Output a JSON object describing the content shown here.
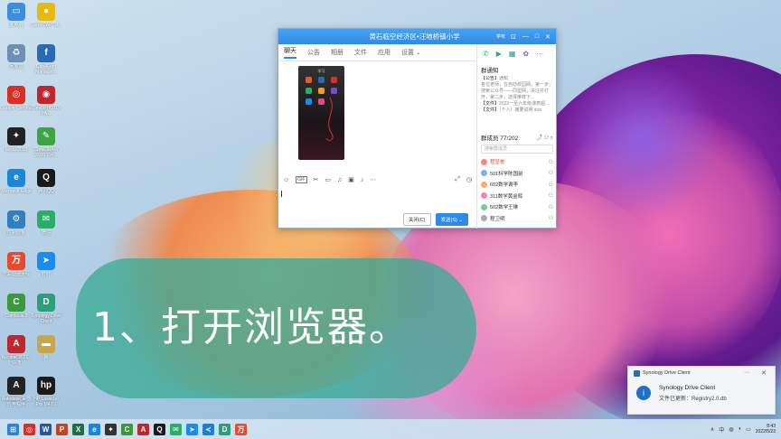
{
  "desktop": {
    "icons": [
      {
        "label": "此电脑",
        "glyph": "▭",
        "color": "#3b8ede"
      },
      {
        "label": "Corel CAPTU...",
        "glyph": "●",
        "color": "#e8b90f"
      },
      {
        "label": "回收站",
        "glyph": "♻",
        "color": "#6b8fb5"
      },
      {
        "label": "CorelFont Manager...",
        "glyph": "f",
        "color": "#2a6ab5"
      },
      {
        "label": "Google Chrome",
        "glyph": "◎",
        "color": "#d93025"
      },
      {
        "label": "Corel PHOTO-PA...",
        "glyph": "◉",
        "color": "#c0262d"
      },
      {
        "label": "faceu 2022",
        "glyph": "✦",
        "color": "#222"
      },
      {
        "label": "CorelDRAW 2020 (64...",
        "glyph": "✎",
        "color": "#3ea343"
      },
      {
        "label": "Microsoft Edge",
        "glyph": "e",
        "color": "#1b87d6"
      },
      {
        "label": "腾讯QQ",
        "glyph": "Q",
        "color": "#1a1a1a"
      },
      {
        "label": "控制面板",
        "glyph": "⚙",
        "color": "#2f7fc1"
      },
      {
        "label": "微信",
        "glyph": "✉",
        "color": "#2aae67"
      },
      {
        "label": "万彩动画大师",
        "glyph": "万",
        "color": "#e84a2f"
      },
      {
        "label": "钉钉",
        "glyph": "➤",
        "color": "#1a8cf0"
      },
      {
        "label": "Camtasia 9",
        "glyph": "C",
        "color": "#3a9a3a"
      },
      {
        "label": "Synology Drive Client",
        "glyph": "D",
        "color": "#2b9f7a"
      },
      {
        "label": "Acrobat 2021 - 快捷",
        "glyph": "A",
        "color": "#c0262d"
      },
      {
        "label": "新",
        "glyph": "▬",
        "color": "#c9a64a"
      },
      {
        "label": "Autodesk 桌面应用程序",
        "glyph": "A",
        "color": "#222"
      },
      {
        "label": "HP LaserJet Pro M47...",
        "glyph": "hp",
        "color": "#1a1a1a"
      }
    ]
  },
  "chat_window": {
    "title": "黄石临空经济区•汪地桥镇小学",
    "title_tag": "学校",
    "tabs": [
      "聊天",
      "公告",
      "相册",
      "文件",
      "应用",
      "设置 ⌄"
    ],
    "active_tab": "聊天",
    "phone_title": "学习",
    "toolbar_icons": [
      "emoji-icon",
      "gif-icon",
      "scissors-icon",
      "folder-icon",
      "music-icon",
      "image-icon",
      "bell-icon",
      "more-icon"
    ],
    "close_label": "关闭(C)",
    "send_label": "发送(S)",
    "side": {
      "notice_title": "群通知",
      "notice_lines": [
        {
          "k": "【公告】",
          "v": "通知"
        },
        {
          "k": "",
          "v": "各位老师，在自动校园网，第一步，搜索公众号——同型网，关注并打开，第二步，选择推荐下..."
        },
        {
          "k": "【文件】",
          "v": "2022一至六年级课表超..."
        },
        {
          "k": "【文件】",
          "v": "（个人）摘要说明.xlsx"
        }
      ],
      "members_label": "群成员 77/202",
      "search_placeholder": "搜索群成员",
      "members": [
        {
          "name": "程显栋",
          "color": "#e84a2f"
        },
        {
          "name": "501科学陈国前",
          "color": "#333"
        },
        {
          "name": "602数学谢李",
          "color": "#333"
        },
        {
          "name": "311数学黄金辉",
          "color": "#333"
        },
        {
          "name": "502数学王琳",
          "color": "#333"
        },
        {
          "name": "程卫明",
          "color": "#333"
        }
      ]
    }
  },
  "overlay": {
    "title": "1、打开浏览器。"
  },
  "toast": {
    "app": "Synology Drive Client",
    "heading": "Synology Drive Client",
    "body": "文件已更新：Registry2.0.db"
  },
  "taskbar": {
    "icons": [
      {
        "name": "start-icon",
        "glyph": "⊞",
        "color": "#2a86d8"
      },
      {
        "name": "chrome-icon",
        "glyph": "◎",
        "color": "#d93025"
      },
      {
        "name": "word-icon",
        "glyph": "W",
        "color": "#2b579a"
      },
      {
        "name": "powerpoint-icon",
        "glyph": "P",
        "color": "#c4441b"
      },
      {
        "name": "excel-icon",
        "glyph": "X",
        "color": "#1d7044"
      },
      {
        "name": "edge-icon",
        "glyph": "e",
        "color": "#1b87d6"
      },
      {
        "name": "faceu-icon",
        "glyph": "✦",
        "color": "#333"
      },
      {
        "name": "camtasia-icon",
        "glyph": "C",
        "color": "#3a9a3a"
      },
      {
        "name": "acrobat-icon",
        "glyph": "A",
        "color": "#c0262d"
      },
      {
        "name": "qq-icon",
        "glyph": "Q",
        "color": "#1a1a1a"
      },
      {
        "name": "wechat-icon",
        "glyph": "✉",
        "color": "#2aae67"
      },
      {
        "name": "dingtalk-icon",
        "glyph": "➤",
        "color": "#1a8cf0"
      },
      {
        "name": "vscode-icon",
        "glyph": "≺",
        "color": "#1e7fd4"
      },
      {
        "name": "synology-icon",
        "glyph": "D",
        "color": "#2b9f7a"
      },
      {
        "name": "wancai-icon",
        "glyph": "万",
        "color": "#e84a2f"
      }
    ],
    "time": "8:43",
    "date": "2022/5/23",
    "lang": "中"
  }
}
